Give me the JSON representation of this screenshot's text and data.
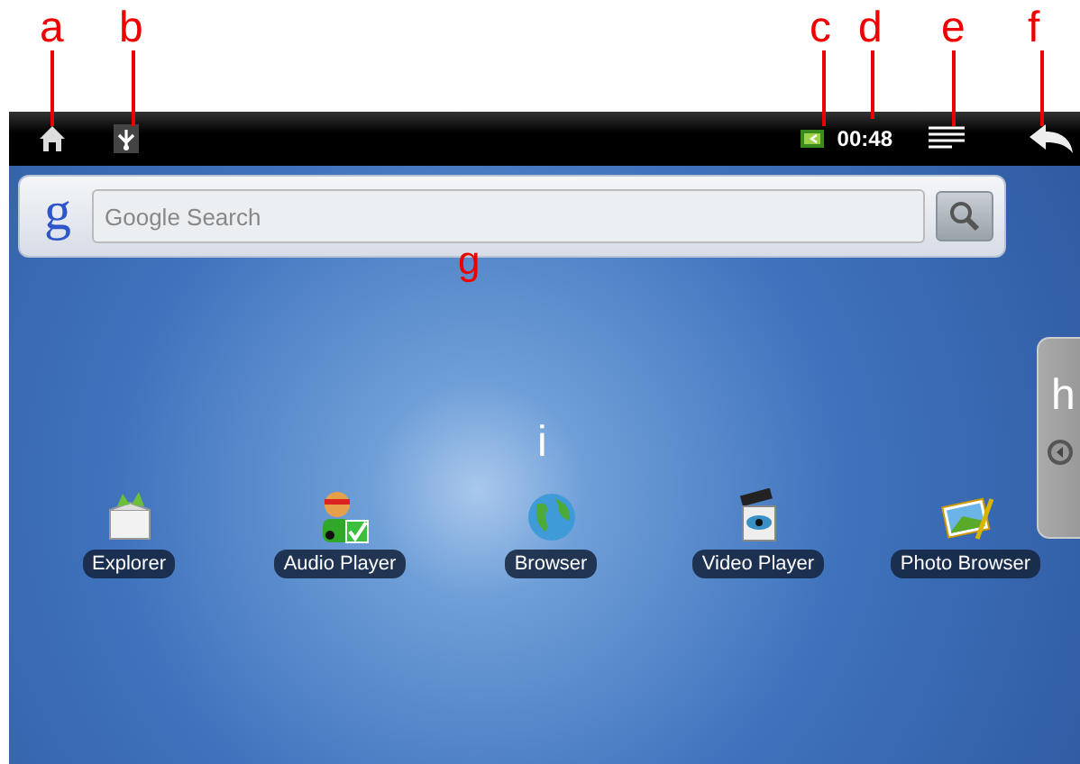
{
  "callouts": [
    {
      "label": "a"
    },
    {
      "label": "b"
    },
    {
      "label": "c"
    },
    {
      "label": "d"
    },
    {
      "label": "e"
    },
    {
      "label": "f"
    },
    {
      "label": "g"
    },
    {
      "label": "h"
    },
    {
      "label": "i"
    }
  ],
  "status_bar": {
    "time": "00:48"
  },
  "search": {
    "logo": "g",
    "placeholder": "Google Search"
  },
  "apps": [
    {
      "label": "Explorer",
      "kind": "box"
    },
    {
      "label": "Audio Player",
      "kind": "audio"
    },
    {
      "label": "Browser",
      "kind": "globe"
    },
    {
      "label": "Video Player",
      "kind": "video"
    },
    {
      "label": "Photo Browser",
      "kind": "photo"
    }
  ]
}
